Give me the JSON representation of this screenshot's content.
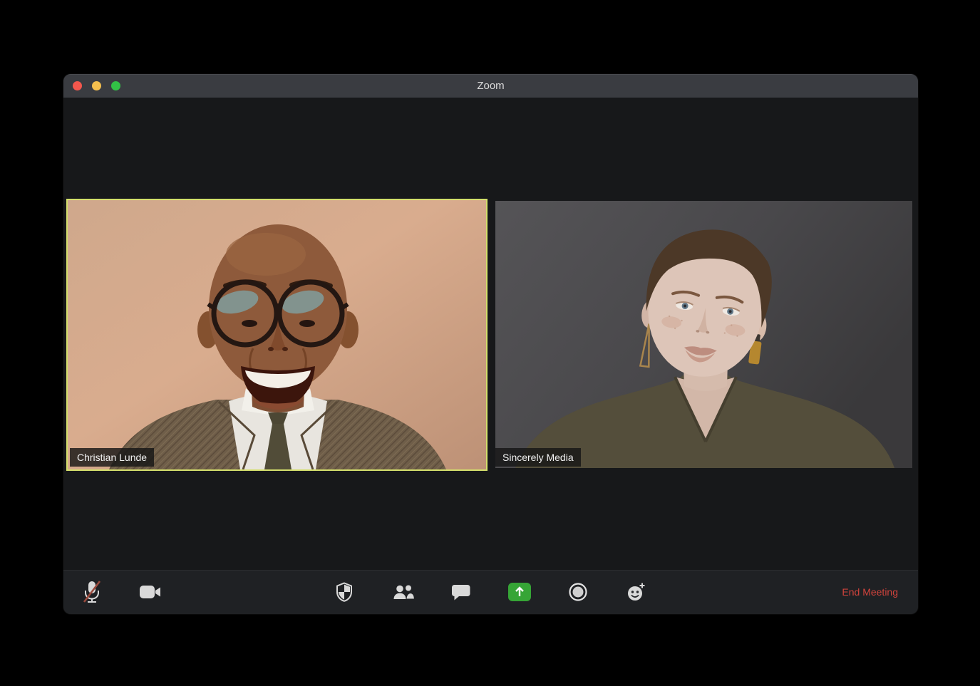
{
  "window": {
    "title": "Zoom",
    "controls": [
      {
        "name": "close",
        "color": "#f4574d"
      },
      {
        "name": "minimize",
        "color": "#f5bf4e"
      },
      {
        "name": "zoom",
        "color": "#32c146"
      }
    ]
  },
  "meeting": {
    "participants": [
      {
        "name": "Christian Lunde",
        "active_speaker": true
      },
      {
        "name": "Sincerely Media",
        "active_speaker": false
      }
    ]
  },
  "toolbar": {
    "buttons": [
      {
        "icon": "microphone-muted-icon",
        "state": "muted"
      },
      {
        "icon": "video-camera-icon"
      },
      {
        "icon": "security-shield-icon"
      },
      {
        "icon": "participants-icon"
      },
      {
        "icon": "chat-bubble-icon"
      },
      {
        "icon": "share-screen-icon"
      },
      {
        "icon": "record-icon"
      },
      {
        "icon": "reactions-smiley-plus-icon"
      }
    ],
    "end_meeting_label": "End Meeting"
  },
  "colors": {
    "window_bg": "#17181a",
    "titlebar_bg": "#3a3c41",
    "toolbar_bg": "#1f2124",
    "active_speaker_border": "#d4df6c",
    "share_green": "#36a536",
    "end_meeting_red": "#d0433c"
  }
}
